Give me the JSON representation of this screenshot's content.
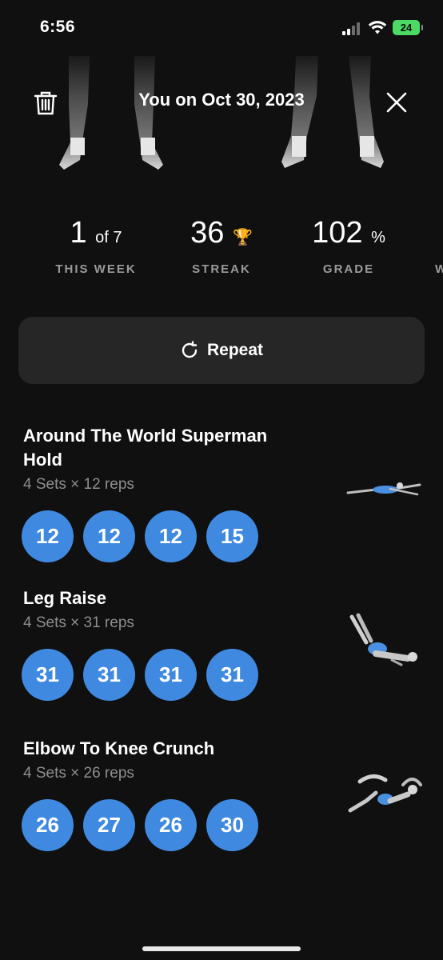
{
  "status_bar": {
    "time": "6:56",
    "battery": "24"
  },
  "header": {
    "title": "You on Oct 30, 2023"
  },
  "stats": [
    {
      "value": "1",
      "suffix": "of 7",
      "label": "THIS WEEK"
    },
    {
      "value": "36",
      "suffix": "🏆",
      "label": "STREAK"
    },
    {
      "value": "102",
      "suffix": "%",
      "label": "GRADE"
    },
    {
      "label": "W"
    }
  ],
  "repeat": {
    "label": "Repeat"
  },
  "exercises": [
    {
      "name": "Around The World Superman Hold",
      "meta": "4 Sets × 12 reps",
      "sets": [
        "12",
        "12",
        "12",
        "15"
      ]
    },
    {
      "name": "Leg Raise",
      "meta": "4 Sets × 31 reps",
      "sets": [
        "31",
        "31",
        "31",
        "31"
      ]
    },
    {
      "name": "Elbow To Knee Crunch",
      "meta": "4 Sets × 26 reps",
      "sets": [
        "26",
        "27",
        "26",
        "30"
      ]
    }
  ],
  "colors": {
    "accent": "#3f8ae0",
    "background": "#101010",
    "card": "#262626",
    "battery": "#4cd964",
    "muted": "#9a9a9a"
  },
  "icons": {
    "trash": "trash-icon",
    "close": "close-icon",
    "repeat": "repeat-icon",
    "trophy": "trophy-icon"
  }
}
